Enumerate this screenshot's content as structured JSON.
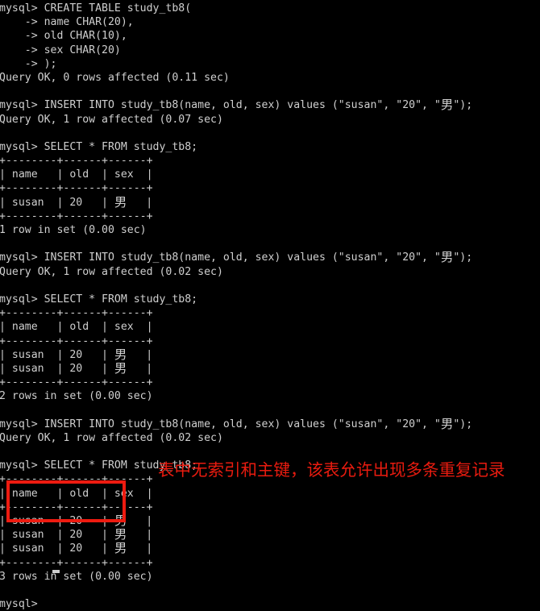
{
  "terminal": {
    "prompt": "mysql>",
    "continuation_prompt": "    ->",
    "foreground_color": "#cfcfcf",
    "background_color": "#000000",
    "cursor": "block-cursor",
    "lines": [
      "mysql> CREATE TABLE study_tb8(",
      "    -> name CHAR(20),",
      "    -> old CHAR(10),",
      "    -> sex CHAR(20)",
      "    -> );",
      "Query OK, 0 rows affected (0.11 sec)",
      "",
      "mysql> INSERT INTO study_tb8(name, old, sex) values (\"susan\", \"20\", \"男\");",
      "Query OK, 1 row affected (0.07 sec)",
      "",
      "mysql> SELECT * FROM study_tb8;",
      "+--------+------+------+",
      "| name   | old  | sex  |",
      "+--------+------+------+",
      "| susan  | 20   | 男   |",
      "+--------+------+------+",
      "1 row in set (0.00 sec)",
      "",
      "mysql> INSERT INTO study_tb8(name, old, sex) values (\"susan\", \"20\", \"男\");",
      "Query OK, 1 row affected (0.02 sec)",
      "",
      "mysql> SELECT * FROM study_tb8;",
      "+--------+------+------+",
      "| name   | old  | sex  |",
      "+--------+------+------+",
      "| susan  | 20   | 男   |",
      "| susan  | 20   | 男   |",
      "+--------+------+------+",
      "2 rows in set (0.00 sec)",
      "",
      "mysql> INSERT INTO study_tb8(name, old, sex) values (\"susan\", \"20\", \"男\");",
      "Query OK, 1 row affected (0.02 sec)",
      "",
      "mysql> SELECT * FROM study_tb8;",
      "+--------+------+------+",
      "| name   | old  | sex  |",
      "+--------+------+------+",
      "| susan  | 20   | 男   |",
      "| susan  | 20   | 男   |",
      "| susan  | 20   | 男   |",
      "+--------+------+------+",
      "3 rows in set (0.00 sec)",
      "",
      "mysql> "
    ]
  },
  "annotation": {
    "text": "表中无索引和主键，该表允许出现多条重复记录",
    "color": "#e81b0f"
  },
  "highlight": {
    "label": "duplicate-rows-highlight",
    "color": "#ee1b10"
  },
  "results": {
    "columns": [
      "name",
      "old",
      "sex"
    ],
    "first_query_rows": [
      [
        "susan",
        "20",
        "男"
      ]
    ],
    "second_query_rows": [
      [
        "susan",
        "20",
        "男"
      ],
      [
        "susan",
        "20",
        "男"
      ]
    ],
    "third_query_rows": [
      [
        "susan",
        "20",
        "男"
      ],
      [
        "susan",
        "20",
        "男"
      ],
      [
        "susan",
        "20",
        "男"
      ]
    ],
    "first_query_status": "1 row in set (0.00 sec)",
    "second_query_status": "2 rows in set (0.00 sec)",
    "third_query_status": "3 rows in set (0.00 sec)"
  }
}
